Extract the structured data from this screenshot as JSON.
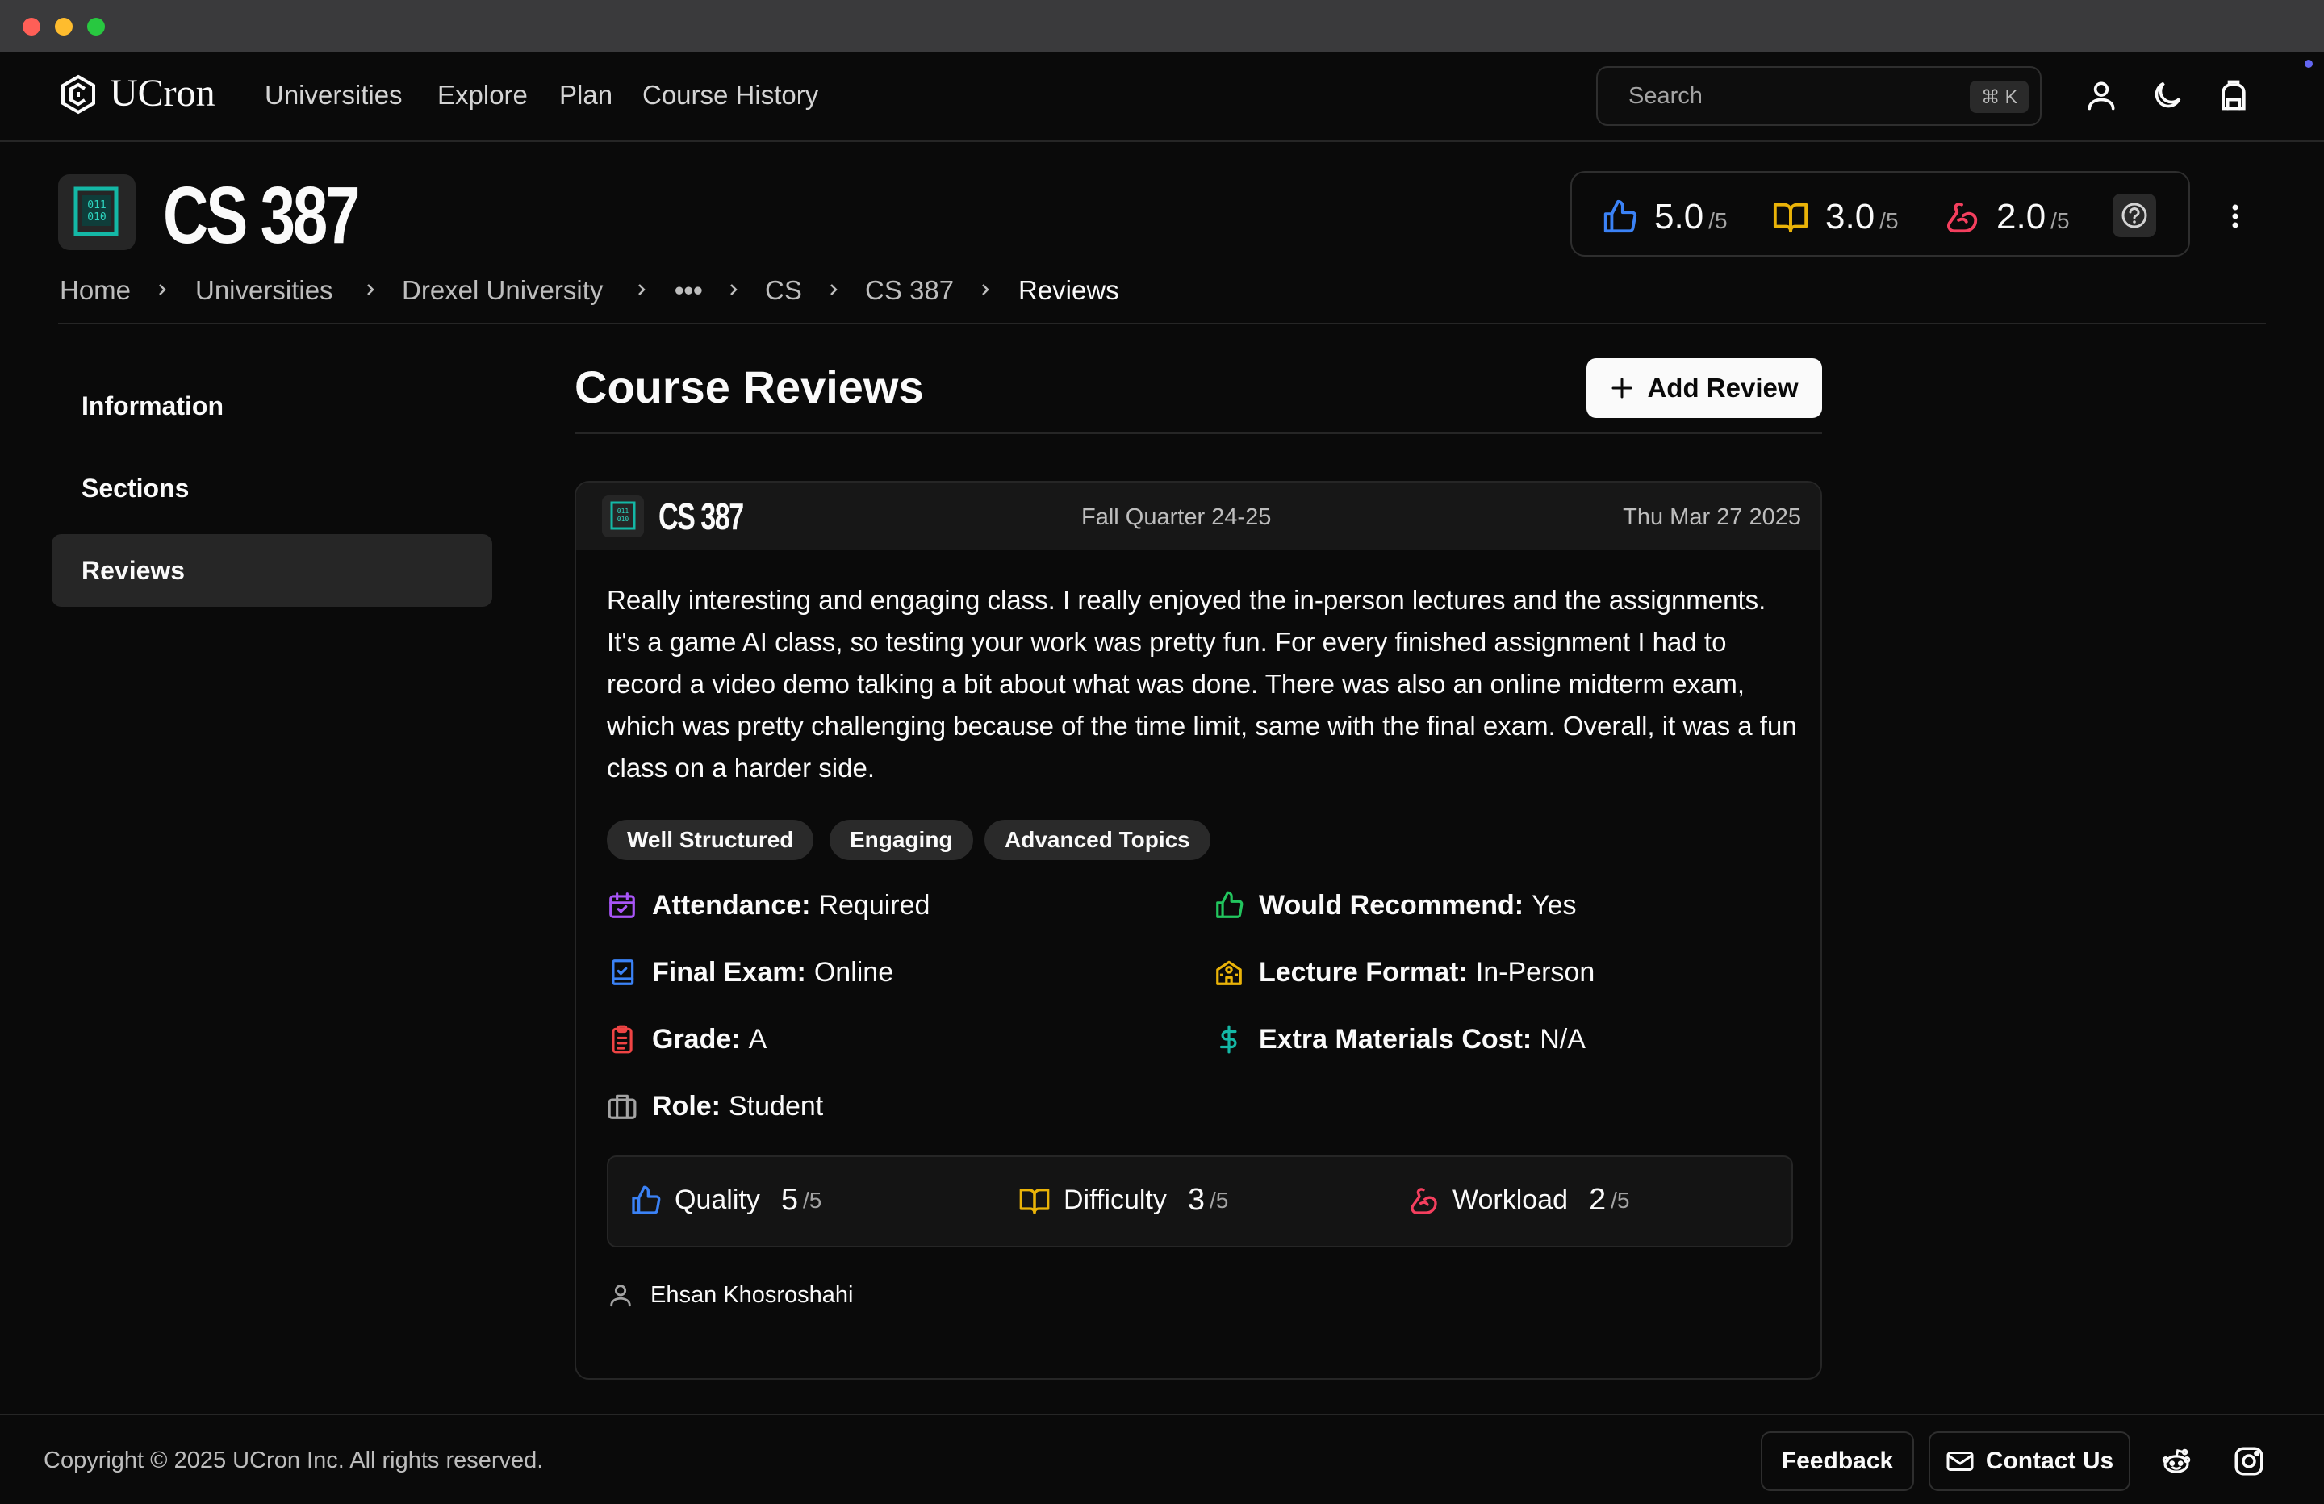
{
  "window": {
    "traffic_colors": [
      "#ff5f57",
      "#febc2e",
      "#28c840"
    ]
  },
  "nav": {
    "brand": "UCron",
    "links": [
      "Universities",
      "Explore",
      "Plan",
      "Course History"
    ],
    "search_placeholder": "Search",
    "search_shortcut": "⌘ K",
    "icons": [
      "user-icon",
      "moon-icon",
      "backpack-icon"
    ]
  },
  "course": {
    "code": "CS 387",
    "ratings": [
      {
        "icon": "thumbs-up-icon",
        "value": "5.0",
        "max": "/5",
        "color": "#3b82f6"
      },
      {
        "icon": "book-open-icon",
        "value": "3.0",
        "max": "/5",
        "color": "#eab308"
      },
      {
        "icon": "flexed-arm-icon",
        "value": "2.0",
        "max": "/5",
        "color": "#f43f5e"
      }
    ]
  },
  "breadcrumb": [
    "Home",
    "Universities",
    "Drexel University",
    "•••",
    "CS",
    "CS 387",
    "Reviews"
  ],
  "sidebar": {
    "items": [
      {
        "label": "Information",
        "active": false
      },
      {
        "label": "Sections",
        "active": false
      },
      {
        "label": "Reviews",
        "active": true
      }
    ]
  },
  "main": {
    "title": "Course Reviews",
    "add_label": "Add Review"
  },
  "review": {
    "course": "CS 387",
    "term": "Fall Quarter 24-25",
    "date": "Thu Mar 27 2025",
    "text": "Really interesting and engaging class. I really enjoyed the in-person lectures and the assignments. It's a game AI class, so testing your work was pretty fun. For every finished assignment I had to record a video demo talking a bit about what was done. There was also an online midterm exam, which was pretty challenging because of the time limit, same with the final exam. Overall, it was a fun class on a harder side.",
    "tags": [
      "Well Structured",
      "Engaging",
      "Advanced Topics"
    ],
    "attributes": [
      {
        "icon": "calendar-check-icon",
        "label": "Attendance:",
        "value": "Required",
        "color": "#a855f7"
      },
      {
        "icon": "thumbs-up-icon",
        "label": "Would Recommend:",
        "value": "Yes",
        "color": "#22c55e"
      },
      {
        "icon": "notebook-check-icon",
        "label": "Final Exam:",
        "value": "Online",
        "color": "#3b82f6"
      },
      {
        "icon": "school-building-icon",
        "label": "Lecture Format:",
        "value": "In-Person",
        "color": "#eab308"
      },
      {
        "icon": "clipboard-list-icon",
        "label": "Grade:",
        "value": "A",
        "color": "#ef4444"
      },
      {
        "icon": "dollar-sign-icon",
        "label": "Extra Materials Cost:",
        "value": "N/A",
        "color": "#14b8a6"
      },
      {
        "icon": "briefcase-icon",
        "label": "Role:",
        "value": "Student",
        "color": "#a3a3a3"
      }
    ],
    "scores": [
      {
        "icon": "thumbs-up-icon",
        "label": "Quality",
        "value": "5",
        "max": "/5",
        "color": "#3b82f6"
      },
      {
        "icon": "book-open-icon",
        "label": "Difficulty",
        "value": "3",
        "max": "/5",
        "color": "#eab308"
      },
      {
        "icon": "flexed-arm-icon",
        "label": "Workload",
        "value": "2",
        "max": "/5",
        "color": "#f43f5e"
      }
    ],
    "author": "Ehsan Khosroshahi"
  },
  "footer": {
    "copyright": "Copyright © 2025 UCron Inc. All rights reserved.",
    "feedback_label": "Feedback",
    "contact_label": "Contact Us",
    "icons": [
      "reddit-icon",
      "instagram-icon"
    ]
  }
}
